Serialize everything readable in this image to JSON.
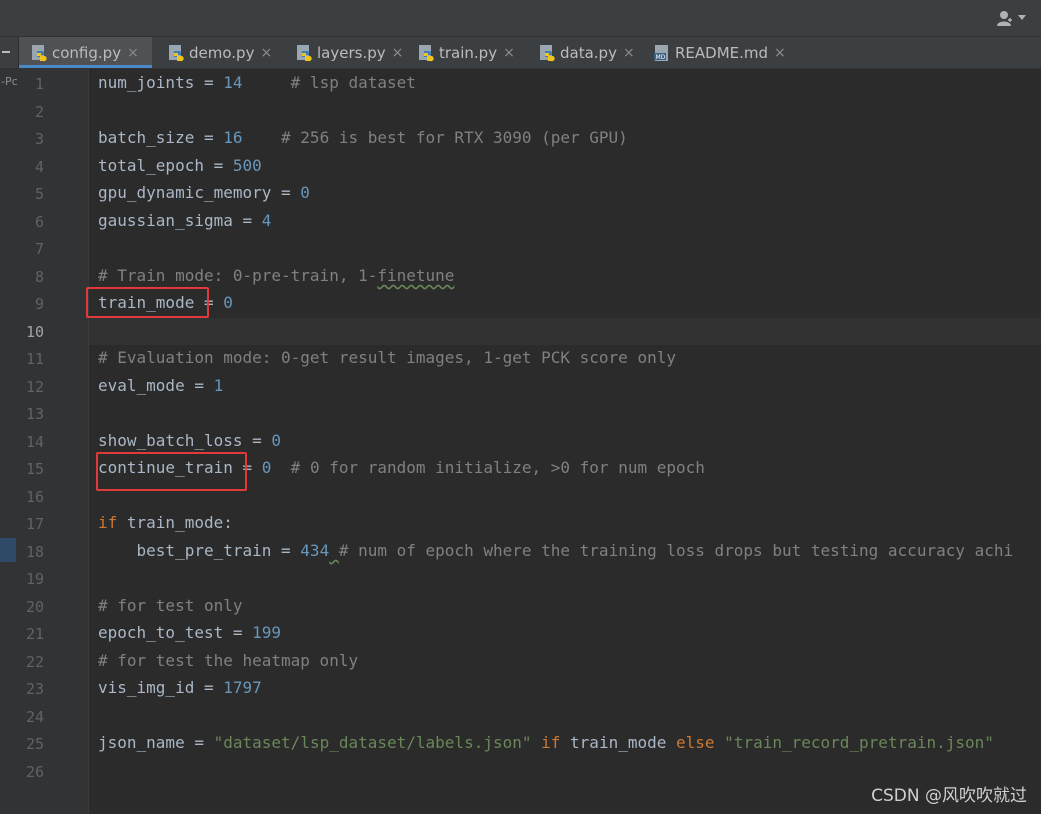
{
  "tabs": [
    {
      "label": "config.py",
      "icon": "python-file-icon",
      "active": true
    },
    {
      "label": "demo.py",
      "icon": "python-file-icon",
      "active": false
    },
    {
      "label": "layers.py",
      "icon": "python-file-icon",
      "active": false
    },
    {
      "label": "train.py",
      "icon": "python-file-icon",
      "active": false
    },
    {
      "label": "data.py",
      "icon": "python-file-icon",
      "active": false
    },
    {
      "label": "README.md",
      "icon": "markdown-file-icon",
      "active": false
    }
  ],
  "side_label": "-Pc",
  "current_line": 10,
  "lines": [
    {
      "n": "1"
    },
    {
      "n": "2"
    },
    {
      "n": "3"
    },
    {
      "n": "4"
    },
    {
      "n": "5"
    },
    {
      "n": "6"
    },
    {
      "n": "7"
    },
    {
      "n": "8"
    },
    {
      "n": "9"
    },
    {
      "n": "10"
    },
    {
      "n": "11"
    },
    {
      "n": "12"
    },
    {
      "n": "13"
    },
    {
      "n": "14"
    },
    {
      "n": "15"
    },
    {
      "n": "16"
    },
    {
      "n": "17"
    },
    {
      "n": "18"
    },
    {
      "n": "19"
    },
    {
      "n": "20"
    },
    {
      "n": "21"
    },
    {
      "n": "22"
    },
    {
      "n": "23"
    },
    {
      "n": "24"
    },
    {
      "n": "25"
    },
    {
      "n": "26"
    }
  ],
  "code": {
    "l1": {
      "name": "num_joints",
      "op": " = ",
      "val": "14",
      "cmt": "     # lsp dataset"
    },
    "l3": {
      "name": "batch_size",
      "op": " = ",
      "val": "16",
      "cmt": "    # 256 is best for RTX 3090 (per GPU)"
    },
    "l4": {
      "name": "total_epoch",
      "op": " = ",
      "val": "500"
    },
    "l5": {
      "name": "gpu_dynamic_memory",
      "op": " = ",
      "val": "0"
    },
    "l6": {
      "name": "gaussian_sigma",
      "op": " = ",
      "val": "4"
    },
    "l8": {
      "cmt_a": "# Train mode: 0-pre-train, 1-",
      "cmt_b": "finetune"
    },
    "l9": {
      "name": "train_mode",
      "op": " = ",
      "val": "0"
    },
    "l11": {
      "cmt": "# Evaluation mode: 0-get result images, 1-get PCK score only"
    },
    "l12": {
      "name": "eval_mode",
      "op": " = ",
      "val": "1"
    },
    "l14": {
      "name": "show_batch_loss",
      "op": " = ",
      "val": "0"
    },
    "l15": {
      "name": "continue_train",
      "op": " = ",
      "val": "0",
      "cmt": "  # 0 for random initialize, >0 for num epoch"
    },
    "l17": {
      "kw": "if",
      "rest": " train_mode:"
    },
    "l18": {
      "indent": "    ",
      "name": "best_pre_train",
      "op": " = ",
      "val": "434",
      "sp": " ",
      "cmt": "# num of epoch where the training loss drops but testing accuracy achi"
    },
    "l20": {
      "cmt": "# for test only"
    },
    "l21": {
      "name": "epoch_to_test",
      "op": " = ",
      "val": "199"
    },
    "l22": {
      "cmt": "# for test the heatmap only"
    },
    "l23": {
      "name": "vis_img_id",
      "op": " = ",
      "val": "1797"
    },
    "l25": {
      "name": "json_name",
      "op": " = ",
      "str1": "\"dataset/lsp_dataset/labels.json\"",
      "kw1": " if",
      "mid": " train_mode",
      "kw2": " else",
      "str2": " \"train_record_pretrain.json\""
    }
  },
  "colors": {
    "annotation_box": "#e03a3a",
    "keyword": "#cc7832",
    "number": "#6897bb",
    "string": "#6a8759",
    "comment": "#808080"
  },
  "watermark": "CSDN @风吹吹就过"
}
